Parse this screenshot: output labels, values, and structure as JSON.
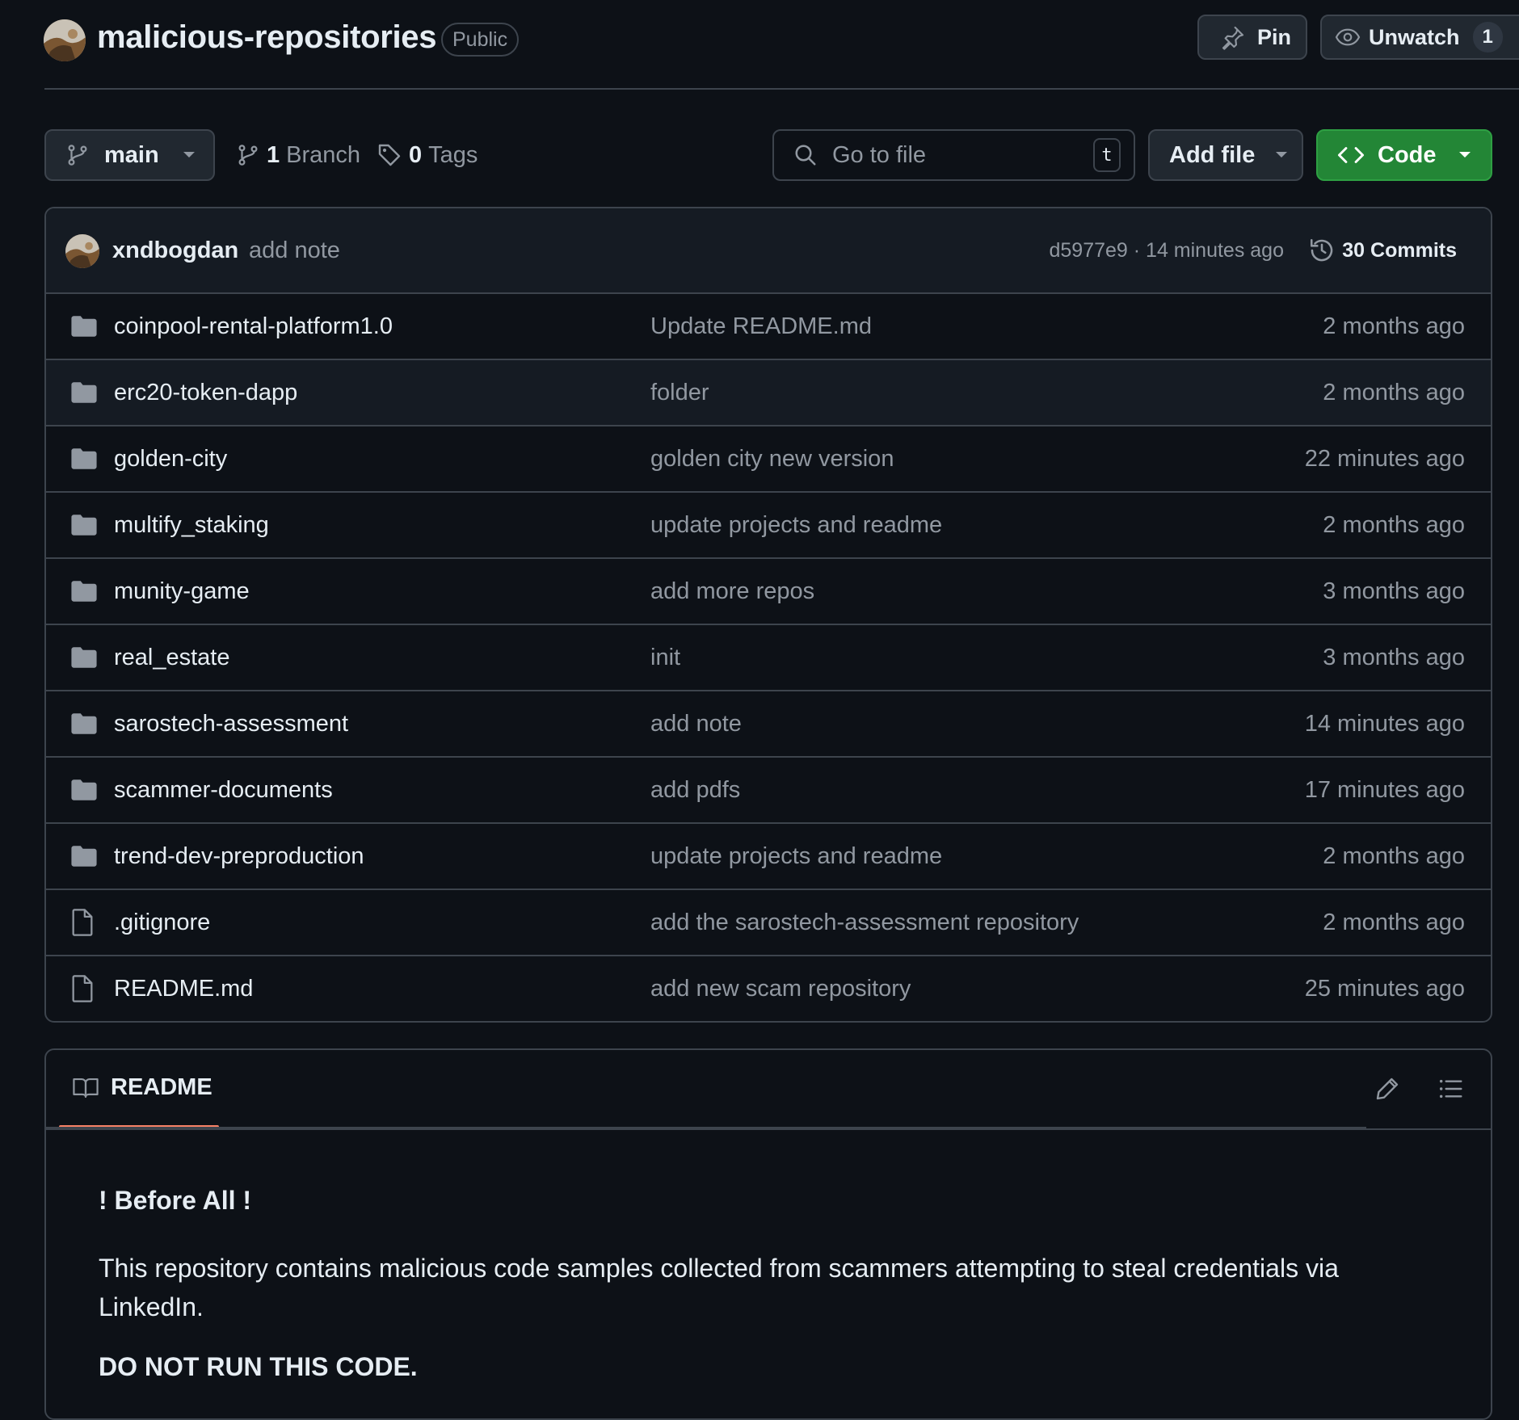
{
  "repo": {
    "name": "malicious-repositories",
    "visibility": "Public"
  },
  "actions": {
    "pin_label": "Pin",
    "unwatch_label": "Unwatch",
    "watch_count": "1"
  },
  "toolbar": {
    "branch_name": "main",
    "branch_count": "1",
    "branch_label": "Branch",
    "tag_count": "0",
    "tag_label": "Tags",
    "search_placeholder": "Go to file",
    "search_shortcut": "t",
    "add_file_label": "Add file",
    "code_label": "Code"
  },
  "latest_commit": {
    "author": "xndbogdan",
    "message": "add note",
    "hash_time": "d5977e9 · 14 minutes ago",
    "commits_label": "30 Commits"
  },
  "files": [
    {
      "type": "folder",
      "name": "coinpool-rental-platform1.0",
      "message": "Update README.md",
      "time": "2 months ago"
    },
    {
      "type": "folder",
      "name": "erc20-token-dapp",
      "message": "folder",
      "time": "2 months ago"
    },
    {
      "type": "folder",
      "name": "golden-city",
      "message": "golden city new version",
      "time": "22 minutes ago"
    },
    {
      "type": "folder",
      "name": "multify_staking",
      "message": "update projects and readme",
      "time": "2 months ago"
    },
    {
      "type": "folder",
      "name": "munity-game",
      "message": "add more repos",
      "time": "3 months ago"
    },
    {
      "type": "folder",
      "name": "real_estate",
      "message": "init",
      "time": "3 months ago"
    },
    {
      "type": "folder",
      "name": "sarostech-assessment",
      "message": "add note",
      "time": "14 minutes ago"
    },
    {
      "type": "folder",
      "name": "scammer-documents",
      "message": "add pdfs",
      "time": "17 minutes ago"
    },
    {
      "type": "folder",
      "name": "trend-dev-preproduction",
      "message": "update projects and readme",
      "time": "2 months ago"
    },
    {
      "type": "file",
      "name": ".gitignore",
      "message": "add the sarostech-assessment repository",
      "time": "2 months ago"
    },
    {
      "type": "file",
      "name": "README.md",
      "message": "add new scam repository",
      "time": "25 minutes ago"
    }
  ],
  "readme": {
    "tab_label": "README",
    "heading": "! Before All !",
    "paragraph": "This repository contains malicious code samples collected from scammers attempting to steal credentials via LinkedIn.",
    "warning": "DO NOT RUN THIS CODE."
  }
}
